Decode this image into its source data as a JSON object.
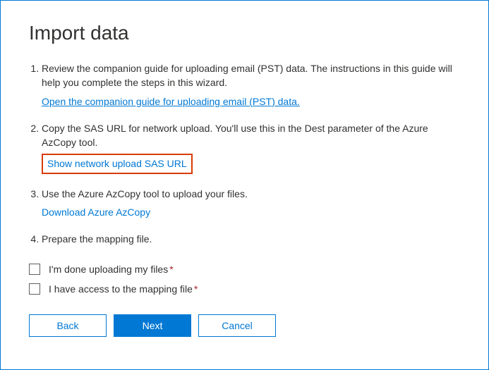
{
  "title": "Import data",
  "steps": {
    "s1": {
      "text": "Review the companion guide for uploading email (PST) data. The instructions in this guide will help you complete the steps in this wizard.",
      "link": "Open the companion guide for uploading email (PST) data."
    },
    "s2": {
      "text": "Copy the SAS URL for network upload. You'll use this in the Dest parameter of the Azure AzCopy tool.",
      "link": "Show network upload SAS URL"
    },
    "s3": {
      "text": "Use the Azure AzCopy tool to upload your files.",
      "link": "Download Azure AzCopy"
    },
    "s4": {
      "text": "Prepare the mapping file."
    }
  },
  "checkboxes": {
    "c1": "I'm done uploading my files",
    "c2": "I have access to the mapping file"
  },
  "required_marker": "*",
  "buttons": {
    "back": "Back",
    "next": "Next",
    "cancel": "Cancel"
  }
}
